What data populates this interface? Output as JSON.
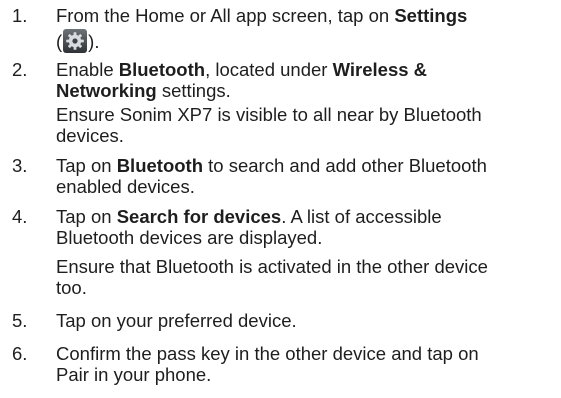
{
  "steps": [
    {
      "num": "1.",
      "l1": {
        "pre": "From the Home or All app screen, tap on ",
        "b": "Settings"
      },
      "l2": {
        "open": "(",
        "close": ")."
      },
      "icon": "settings-gear-icon"
    },
    {
      "num": "2.",
      "l1": {
        "pre": "Enable ",
        "b1": "Bluetooth",
        "mid": ", located under ",
        "b2": "Wireless &"
      },
      "l2": {
        "b": "Networking",
        "post": " settings."
      },
      "note1": "Ensure Sonim XP7 is visible to all near by Bluetooth",
      "note2": "devices."
    },
    {
      "num": "3.",
      "l1": {
        "pre": "Tap on ",
        "b": "Bluetooth",
        "post": " to search and add other Bluetooth"
      },
      "l2": "enabled devices."
    },
    {
      "num": "4.",
      "l1": {
        "pre": "Tap on ",
        "b": "Search for devices",
        "post": ". A list of accessible"
      },
      "l2": "Bluetooth devices are displayed.",
      "note1": "Ensure that Bluetooth is activated in the other device",
      "note2": "too."
    },
    {
      "num": "5.",
      "l1": "Tap on your preferred device."
    },
    {
      "num": "6.",
      "l1": "Confirm the pass key in the other device and tap on",
      "l2": "Pair in your phone."
    }
  ]
}
